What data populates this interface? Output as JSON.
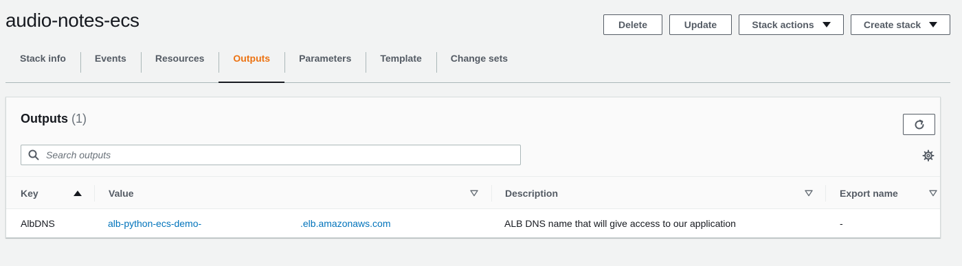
{
  "page": {
    "title": "audio-notes-ecs"
  },
  "actions": {
    "delete": "Delete",
    "update": "Update",
    "stack_actions": "Stack actions",
    "create_stack": "Create stack"
  },
  "tabs": [
    {
      "label": "Stack info"
    },
    {
      "label": "Events"
    },
    {
      "label": "Resources"
    },
    {
      "label": "Outputs",
      "active": true
    },
    {
      "label": "Parameters"
    },
    {
      "label": "Template"
    },
    {
      "label": "Change sets"
    }
  ],
  "outputs": {
    "title": "Outputs",
    "count": "(1)",
    "search_placeholder": "Search outputs",
    "columns": {
      "key": "Key",
      "value": "Value",
      "description": "Description",
      "export_name": "Export name"
    },
    "rows": [
      {
        "key": "AlbDNS",
        "value_prefix": "alb-python-ecs-demo-",
        "value_suffix": ".elb.amazonaws.com",
        "description": "ALB DNS name that will give access to our application",
        "export_name": "-"
      }
    ]
  },
  "colors": {
    "accent": "#ec7211",
    "link": "#0073bb",
    "text": "#16191f",
    "muted": "#545b64"
  },
  "icons": {
    "refresh": "refresh-icon",
    "settings": "gear-icon",
    "search": "search-icon"
  }
}
